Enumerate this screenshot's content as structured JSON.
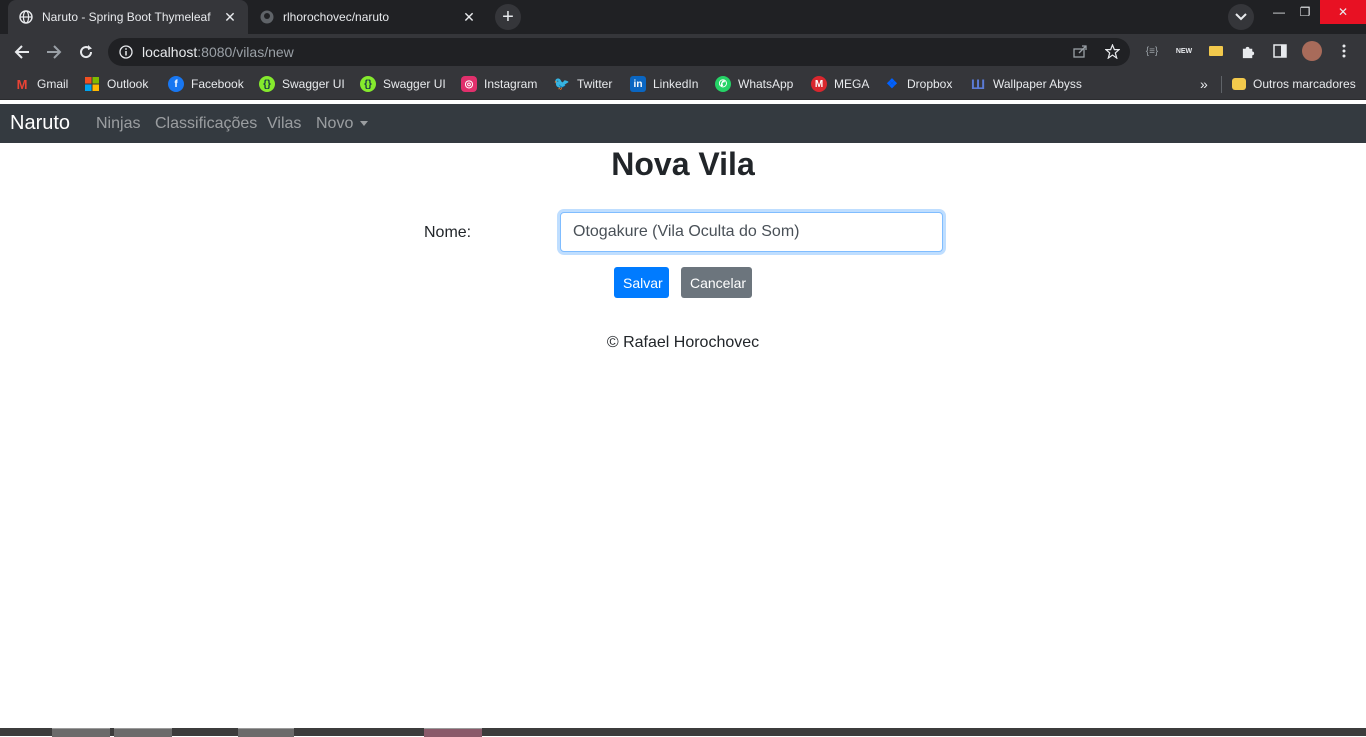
{
  "browser": {
    "tabs": [
      {
        "title": "Naruto - Spring Boot Thymeleaf",
        "active": true,
        "favicon": "globe-icon"
      },
      {
        "title": "rlhorochovec/naruto",
        "active": false,
        "favicon": "github-icon"
      }
    ],
    "url_host": "localhost",
    "url_rest": ":8080/vilas/new"
  },
  "bookmarks": [
    {
      "label": "Gmail",
      "icon": "gmail-icon",
      "color": "#ea4335"
    },
    {
      "label": "Outlook",
      "icon": "windows-icon",
      "color": "#f25022"
    },
    {
      "label": "Facebook",
      "icon": "facebook-icon",
      "color": "#1877f2"
    },
    {
      "label": "Swagger UI",
      "icon": "swagger-icon",
      "color": "#85ea2d"
    },
    {
      "label": "Swagger UI",
      "icon": "swagger-icon",
      "color": "#85ea2d"
    },
    {
      "label": "Instagram",
      "icon": "instagram-icon",
      "color": "#e1306c"
    },
    {
      "label": "Twitter",
      "icon": "twitter-icon",
      "color": "#1da1f2"
    },
    {
      "label": "LinkedIn",
      "icon": "linkedin-icon",
      "color": "#0a66c2"
    },
    {
      "label": "WhatsApp",
      "icon": "whatsapp-icon",
      "color": "#25d366"
    },
    {
      "label": "MEGA",
      "icon": "mega-icon",
      "color": "#d9272e"
    },
    {
      "label": "Dropbox",
      "icon": "dropbox-icon",
      "color": "#0061ff"
    },
    {
      "label": "Wallpaper Abyss",
      "icon": "wallpaper-icon",
      "color": "#5b7bd5"
    }
  ],
  "bookmarks_other": "Outros marcadores",
  "navbar": {
    "brand": "Naruto",
    "links": [
      "Ninjas",
      "Classificações",
      "Vilas",
      "Novo"
    ]
  },
  "page": {
    "title": "Nova Vila",
    "name_label": "Nome:",
    "name_value": "Otogakure (Vila Oculta do Som)",
    "save_label": "Salvar",
    "cancel_label": "Cancelar",
    "footer": "© Rafael Horochovec"
  }
}
